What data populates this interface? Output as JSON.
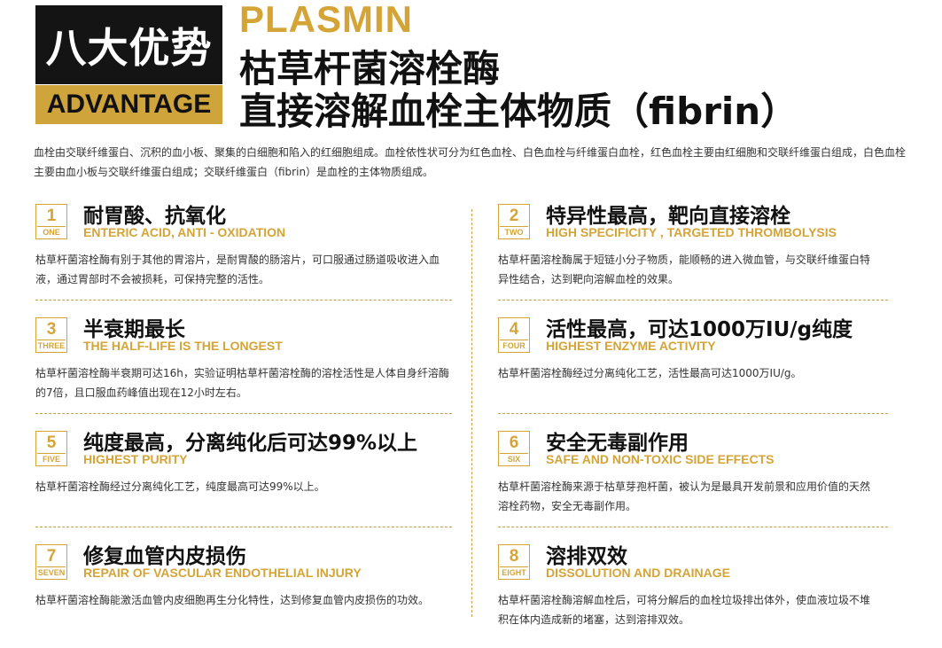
{
  "header": {
    "badge_cn": "八大优势",
    "badge_en": "ADVANTAGE",
    "brand": "PLASMIN",
    "title_line1": "枯草杆菌溶栓酶",
    "title_line2": "直接溶解血栓主体物质（fibrin）"
  },
  "intro": "血栓由交联纤维蛋白、沉积的血小板、聚集的白细胞和陷入的红细胞组成。血栓依性状可分为红色血栓、白色血栓与纤维蛋白血栓，红色血栓主要由红细胞和交联纤维蛋白组成，白色血栓主要由血小板与交联纤维蛋白组成；交联纤维蛋白（fibrin）是血栓的主体物质组成。",
  "advantages": [
    {
      "num": "1",
      "word": "ONE",
      "title": "耐胃酸、抗氧化",
      "subtitle": "ENTERIC ACID, ANTI - OXIDATION",
      "desc": "枯草杆菌溶栓酶有别于其他的胃溶片，是耐胃酸的肠溶片，可口服通过肠道吸收进入血液，通过胃部时不会被损耗，可保持完整的活性。"
    },
    {
      "num": "2",
      "word": "TWO",
      "title": "特异性最高，靶向直接溶栓",
      "subtitle": "HIGH SPECIFICITY , TARGETED THROMBOLYSIS",
      "desc": "枯草杆菌溶栓酶属于短链小分子物质，能顺畅的进入微血管，与交联纤维蛋白特异性结合，达到靶向溶解血栓的效果。"
    },
    {
      "num": "3",
      "word": "THREE",
      "title": "半衰期最长",
      "subtitle": "THE HALF-LIFE IS THE LONGEST",
      "desc": "枯草杆菌溶栓酶半衰期可达16h，实验证明枯草杆菌溶栓酶的溶栓活性是人体自身纤溶酶的7倍，且口服血药峰值出现在12小时左右。"
    },
    {
      "num": "4",
      "word": "FOUR",
      "title": "活性最高，可达1000万IU/g纯度",
      "subtitle": "HIGHEST ENZYME ACTIVITY",
      "desc": "枯草杆菌溶栓酶经过分离纯化工艺，活性最高可达1000万IU/g。"
    },
    {
      "num": "5",
      "word": "FIVE",
      "title": "纯度最高，分离纯化后可达99%以上",
      "subtitle": "HIGHEST PURITY",
      "desc": "枯草杆菌溶栓酶经过分离纯化工艺，纯度最高可达99%以上。"
    },
    {
      "num": "6",
      "word": "SIX",
      "title": "安全无毒副作用",
      "subtitle": "SAFE AND NON-TOXIC SIDE EFFECTS",
      "desc": "枯草杆菌溶栓酶来源于枯草芽孢杆菌，被认为是最具开发前景和应用价值的天然溶栓药物，安全无毒副作用。"
    },
    {
      "num": "7",
      "word": "SEVEN",
      "title": "修复血管内皮损伤",
      "subtitle": "REPAIR OF VASCULAR ENDOTHELIAL INJURY",
      "desc": "枯草杆菌溶栓酶能激活血管内皮细胞再生分化特性，达到修复血管内皮损伤的功效。"
    },
    {
      "num": "8",
      "word": "EIGHT",
      "title": "溶排双效",
      "subtitle": "DISSOLUTION AND DRAINAGE",
      "desc": "枯草杆菌溶栓酶溶解血栓后，可将分解后的血栓垃圾排出体外，使血液垃圾不堆积在体内造成新的堵塞，达到溶排双效。"
    }
  ],
  "colors": {
    "accent": "#d4a437",
    "badge_bg": "#141414"
  }
}
